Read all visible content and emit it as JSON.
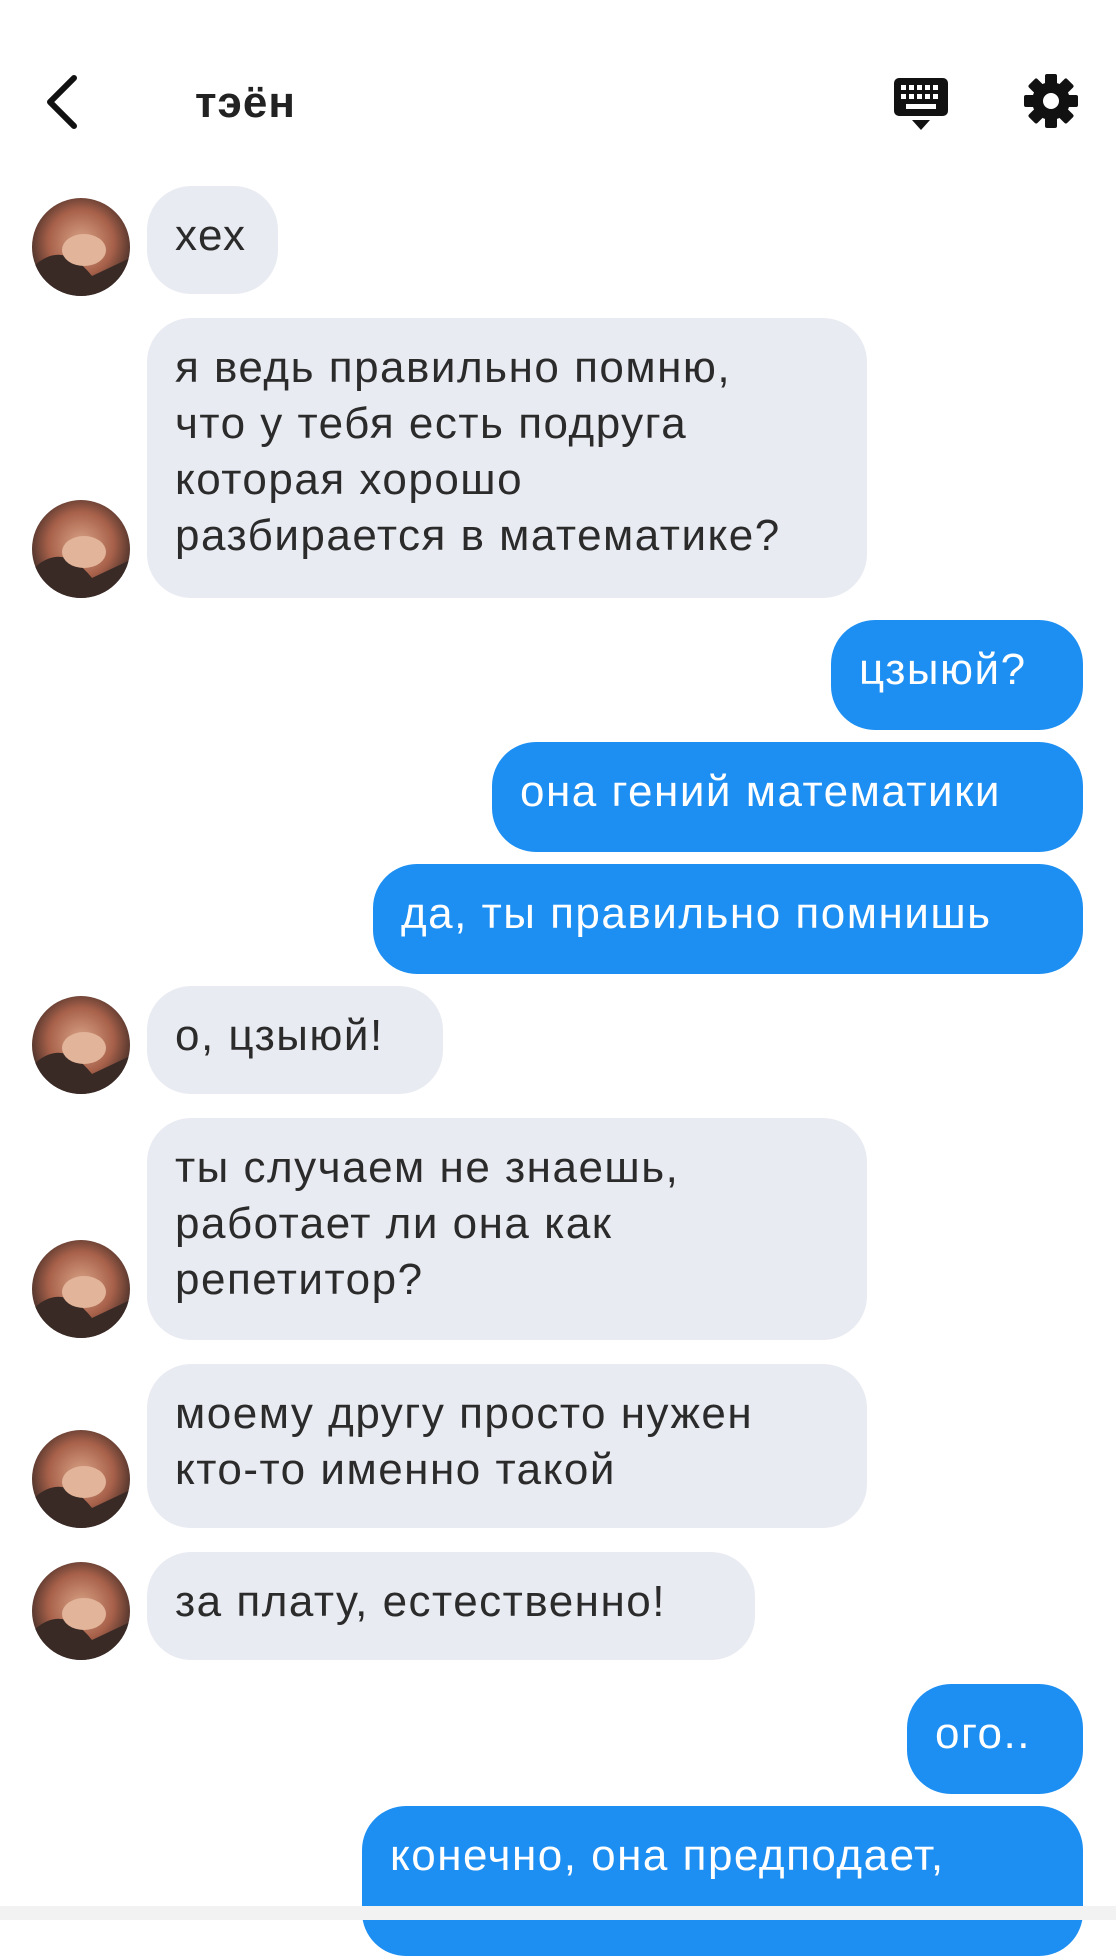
{
  "header": {
    "title": "тэён"
  },
  "icons": {
    "back": "chevron-left-icon",
    "keyboard": "keyboard-icon",
    "settings": "gear-icon"
  },
  "colors": {
    "incoming_bubble": "#e9ebf2",
    "outgoing_bubble": "#1d8ff2"
  },
  "messages": [
    {
      "from": "contact",
      "text": "хех"
    },
    {
      "from": "contact",
      "text": "я ведь правильно помню,\nчто у тебя есть подруга\nкоторая хорошо\nразбирается в математике?"
    },
    {
      "from": "me",
      "text": "цзыюй?"
    },
    {
      "from": "me",
      "text": "она гений математики"
    },
    {
      "from": "me",
      "text": "да, ты правильно помнишь"
    },
    {
      "from": "contact",
      "text": "о, цзыюй!"
    },
    {
      "from": "contact",
      "text": "ты случаем не знаешь,\nработает ли она как\nрепетитор?"
    },
    {
      "from": "contact",
      "text": "моему другу просто нужен\nкто-то именно такой"
    },
    {
      "from": "contact",
      "text": "за плату, естественно!"
    },
    {
      "from": "me",
      "text": "ого.."
    },
    {
      "from": "me",
      "text": "конечно, она предподает,"
    }
  ]
}
